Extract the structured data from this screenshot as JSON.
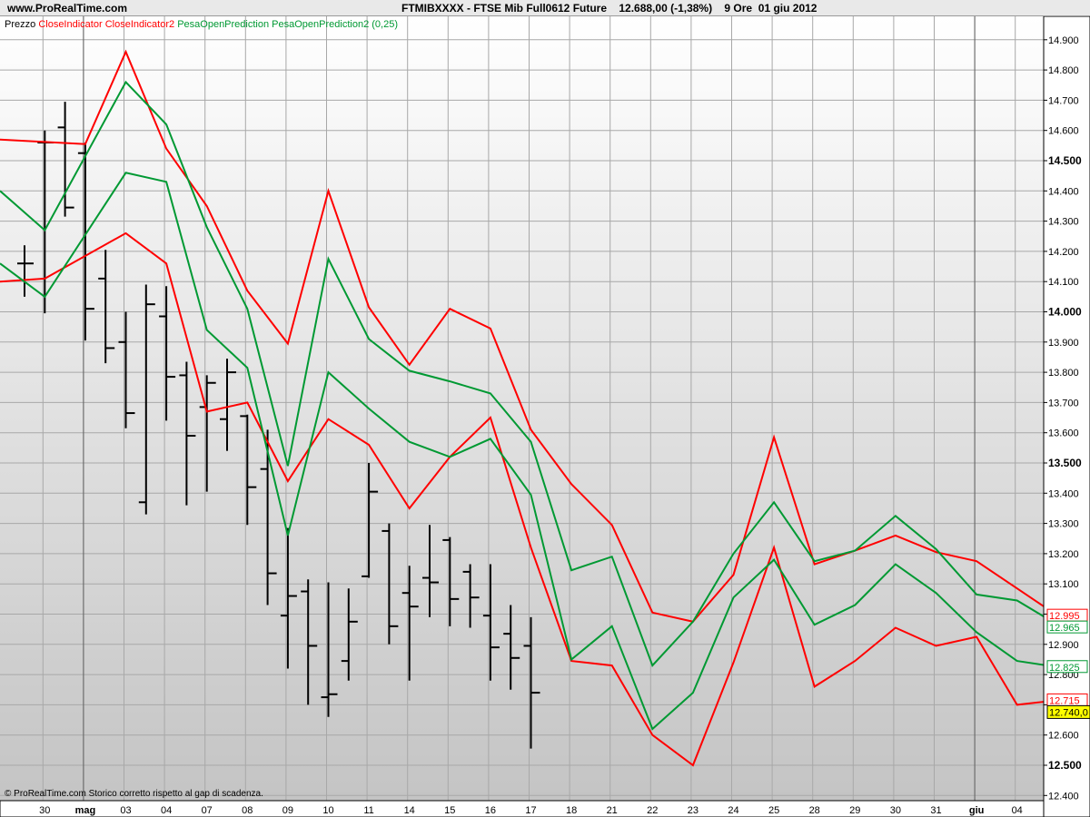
{
  "header": {
    "site": "www.ProRealTime.com",
    "title": "FTMIBXXXX - FTSE Mib Full0612 Future    12.688,00 (-1,38%)    9 Ore  01 giu 2012"
  },
  "legend": {
    "price": "Prezzo",
    "close1": "CloseIndicator",
    "close2": "CloseIndicator2",
    "pesa1": "PesaOpenPrediction",
    "pesa2": "PesaOpenPrediction2 (0,25)"
  },
  "footer_note": "© ProRealTime.com  Storico corretto rispetto al gap di scadenza.",
  "colors": {
    "red": "#ff0000",
    "green": "#009933",
    "bars": "#000000",
    "background": "#d0d0d0",
    "last_price_badge": "#ffff00"
  },
  "chart_data": {
    "type": "ohlc",
    "ylim": [
      12400,
      14950
    ],
    "y_ticks": [
      12400,
      12500,
      12600,
      12700,
      12800,
      12900,
      13000,
      13100,
      13200,
      13300,
      13400,
      13500,
      13600,
      13700,
      13800,
      13900,
      14000,
      14100,
      14200,
      14300,
      14400,
      14500,
      14600,
      14700,
      14800,
      14900
    ],
    "y_tick_labels": [
      "12.400",
      "12.500",
      "12.600",
      "12.700",
      "12.800",
      "12.900",
      "13.000",
      "13.100",
      "13.200",
      "13.300",
      "13.400",
      "13.500",
      "13.600",
      "13.700",
      "13.800",
      "13.900",
      "14.000",
      "14.100",
      "14.200",
      "14.300",
      "14.400",
      "14.500",
      "14.600",
      "14.700",
      "14.800",
      "14.900"
    ],
    "y_bold_values": [
      12500,
      13000,
      13500,
      14000,
      14500
    ],
    "x_labels": [
      "30",
      "mag",
      "03",
      "04",
      "07",
      "08",
      "09",
      "10",
      "11",
      "14",
      "15",
      "16",
      "17",
      "18",
      "21",
      "22",
      "23",
      "24",
      "25",
      "28",
      "29",
      "30",
      "31",
      "giu",
      "04"
    ],
    "x_bold_labels": [
      "mag",
      "giu"
    ],
    "x_label_slots": [
      1,
      2,
      3,
      4,
      5,
      6,
      7,
      8,
      9,
      10,
      11,
      12,
      13,
      14,
      15,
      16,
      17,
      18,
      19,
      20,
      21,
      22,
      23,
      24,
      25
    ],
    "month_separator_slots": [
      2,
      24
    ],
    "bars": [
      {
        "slot": 0.5,
        "open": 14160,
        "high": 14220,
        "low": 14050,
        "close": 14160
      },
      {
        "slot": 1.0,
        "open": 14560,
        "high": 14600,
        "low": 13995,
        "close": 14560
      },
      {
        "slot": 1.5,
        "open": 14610,
        "high": 14695,
        "low": 14315,
        "close": 14345
      },
      {
        "slot": 2.0,
        "open": 14525,
        "high": 14560,
        "low": 13905,
        "close": 14010
      },
      {
        "slot": 2.5,
        "open": 14110,
        "high": 14205,
        "low": 13830,
        "close": 13880
      },
      {
        "slot": 3.0,
        "open": 13900,
        "high": 14000,
        "low": 13615,
        "close": 13665
      },
      {
        "slot": 3.5,
        "open": 13370,
        "high": 14090,
        "low": 13330,
        "close": 14025
      },
      {
        "slot": 4.0,
        "open": 13985,
        "high": 14085,
        "low": 13640,
        "close": 13785
      },
      {
        "slot": 4.5,
        "open": 13790,
        "high": 13835,
        "low": 13360,
        "close": 13590
      },
      {
        "slot": 5.0,
        "open": 13685,
        "high": 13790,
        "low": 13405,
        "close": 13765
      },
      {
        "slot": 5.5,
        "open": 13645,
        "high": 13845,
        "low": 13540,
        "close": 13800
      },
      {
        "slot": 6.0,
        "open": 13655,
        "high": 13660,
        "low": 13295,
        "close": 13420
      },
      {
        "slot": 6.5,
        "open": 13480,
        "high": 13610,
        "low": 13030,
        "close": 13135
      },
      {
        "slot": 7.0,
        "open": 12995,
        "high": 13285,
        "low": 12820,
        "close": 13060
      },
      {
        "slot": 7.5,
        "open": 13075,
        "high": 13115,
        "low": 12700,
        "close": 12895
      },
      {
        "slot": 8.0,
        "open": 12725,
        "high": 13105,
        "low": 12660,
        "close": 12735
      },
      {
        "slot": 8.5,
        "open": 12845,
        "high": 13085,
        "low": 12780,
        "close": 12975
      },
      {
        "slot": 9.0,
        "open": 13125,
        "high": 13500,
        "low": 13120,
        "close": 13405
      },
      {
        "slot": 9.5,
        "open": 13275,
        "high": 13300,
        "low": 12900,
        "close": 12960
      },
      {
        "slot": 10.0,
        "open": 13070,
        "high": 13160,
        "low": 12780,
        "close": 13025
      },
      {
        "slot": 10.5,
        "open": 13120,
        "high": 13295,
        "low": 12990,
        "close": 13105
      },
      {
        "slot": 11.0,
        "open": 13245,
        "high": 13255,
        "low": 12960,
        "close": 13050
      },
      {
        "slot": 11.5,
        "open": 13140,
        "high": 13165,
        "low": 12955,
        "close": 13055
      },
      {
        "slot": 12.0,
        "open": 12995,
        "high": 13165,
        "low": 12780,
        "close": 12890
      },
      {
        "slot": 12.5,
        "open": 12935,
        "high": 13030,
        "low": 12750,
        "close": 12855
      },
      {
        "slot": 13.0,
        "open": 12895,
        "high": 12990,
        "low": 12555,
        "close": 12740
      }
    ],
    "series": [
      {
        "name": "CloseIndicator",
        "color": "#ff0000",
        "points": [
          [
            0,
            14570
          ],
          [
            1,
            14555
          ],
          [
            1.5,
            14860
          ],
          [
            2,
            14540
          ],
          [
            2.5,
            14350
          ],
          [
            3,
            14070
          ],
          [
            3.5,
            13895
          ],
          [
            4,
            14400
          ],
          [
            4.5,
            14015
          ],
          [
            5,
            13825
          ],
          [
            5.5,
            14010
          ],
          [
            6,
            13945
          ],
          [
            6.5,
            13610
          ],
          [
            7,
            13430
          ],
          [
            7.5,
            13295
          ],
          [
            8,
            13005
          ],
          [
            8.5,
            12975
          ],
          [
            9,
            13130
          ],
          [
            9.5,
            13585
          ],
          [
            10,
            13165
          ],
          [
            10.5,
            13210
          ],
          [
            11,
            13260
          ],
          [
            11.5,
            13205
          ],
          [
            12,
            13175
          ],
          [
            12.5,
            13085
          ],
          [
            13,
            12995
          ]
        ]
      },
      {
        "name": "CloseIndicator2",
        "color": "#ff0000",
        "points": [
          [
            0,
            14100
          ],
          [
            0.5,
            14110
          ],
          [
            1.5,
            14260
          ],
          [
            2,
            14160
          ],
          [
            2.5,
            13670
          ],
          [
            3,
            13700
          ],
          [
            3.5,
            13440
          ],
          [
            4,
            13645
          ],
          [
            4.5,
            13560
          ],
          [
            5,
            13350
          ],
          [
            5.5,
            13520
          ],
          [
            6,
            13650
          ],
          [
            6.5,
            13220
          ],
          [
            7,
            12845
          ],
          [
            7.5,
            12830
          ],
          [
            8,
            12600
          ],
          [
            8.5,
            12500
          ],
          [
            9,
            12840
          ],
          [
            9.5,
            13220
          ],
          [
            10,
            12760
          ],
          [
            10.5,
            12845
          ],
          [
            11,
            12955
          ],
          [
            11.5,
            12895
          ],
          [
            12,
            12925
          ],
          [
            12.5,
            12700
          ],
          [
            13,
            12715
          ]
        ]
      },
      {
        "name": "PesaOpenPrediction",
        "color": "#009933",
        "points": [
          [
            0,
            14400
          ],
          [
            0.5,
            14270
          ],
          [
            1.5,
            14760
          ],
          [
            2,
            14620
          ],
          [
            2.5,
            14280
          ],
          [
            3,
            14010
          ],
          [
            3.5,
            13490
          ],
          [
            4,
            14175
          ],
          [
            4.5,
            13910
          ],
          [
            5,
            13805
          ],
          [
            5.5,
            13770
          ],
          [
            6,
            13730
          ],
          [
            6.5,
            13570
          ],
          [
            7,
            13145
          ],
          [
            7.5,
            13190
          ],
          [
            8,
            12830
          ],
          [
            8.5,
            12975
          ],
          [
            9,
            13200
          ],
          [
            9.5,
            13370
          ],
          [
            10,
            13175
          ],
          [
            10.5,
            13210
          ],
          [
            11,
            13325
          ],
          [
            11.5,
            13215
          ],
          [
            12,
            13065
          ],
          [
            12.5,
            13045
          ],
          [
            13,
            12965
          ]
        ]
      },
      {
        "name": "PesaOpenPrediction2 (0,25)",
        "color": "#009933",
        "points": [
          [
            0,
            14160
          ],
          [
            0.5,
            14050
          ],
          [
            1.5,
            14460
          ],
          [
            2,
            14430
          ],
          [
            2.5,
            13940
          ],
          [
            3,
            13815
          ],
          [
            3.5,
            13260
          ],
          [
            4,
            13800
          ],
          [
            4.5,
            13680
          ],
          [
            5,
            13570
          ],
          [
            5.5,
            13520
          ],
          [
            6,
            13580
          ],
          [
            6.5,
            13395
          ],
          [
            7,
            12850
          ],
          [
            7.5,
            12960
          ],
          [
            8,
            12620
          ],
          [
            8.5,
            12740
          ],
          [
            9,
            13055
          ],
          [
            9.5,
            13180
          ],
          [
            10,
            12965
          ],
          [
            10.5,
            13030
          ],
          [
            11,
            13165
          ],
          [
            11.5,
            13070
          ],
          [
            12,
            12940
          ],
          [
            12.5,
            12845
          ],
          [
            13,
            12825
          ]
        ]
      }
    ],
    "right_labels": [
      {
        "text": "12.995",
        "value": 12995,
        "color": "#ff0000"
      },
      {
        "text": "12.965",
        "value": 12965,
        "color": "#009933"
      },
      {
        "text": "12.825",
        "value": 12825,
        "color": "#009933"
      },
      {
        "text": "12.715",
        "value": 12715,
        "color": "#ff0000"
      },
      {
        "text": "12.740,0",
        "value": 12740,
        "color": "#000000",
        "badge": true
      }
    ]
  }
}
